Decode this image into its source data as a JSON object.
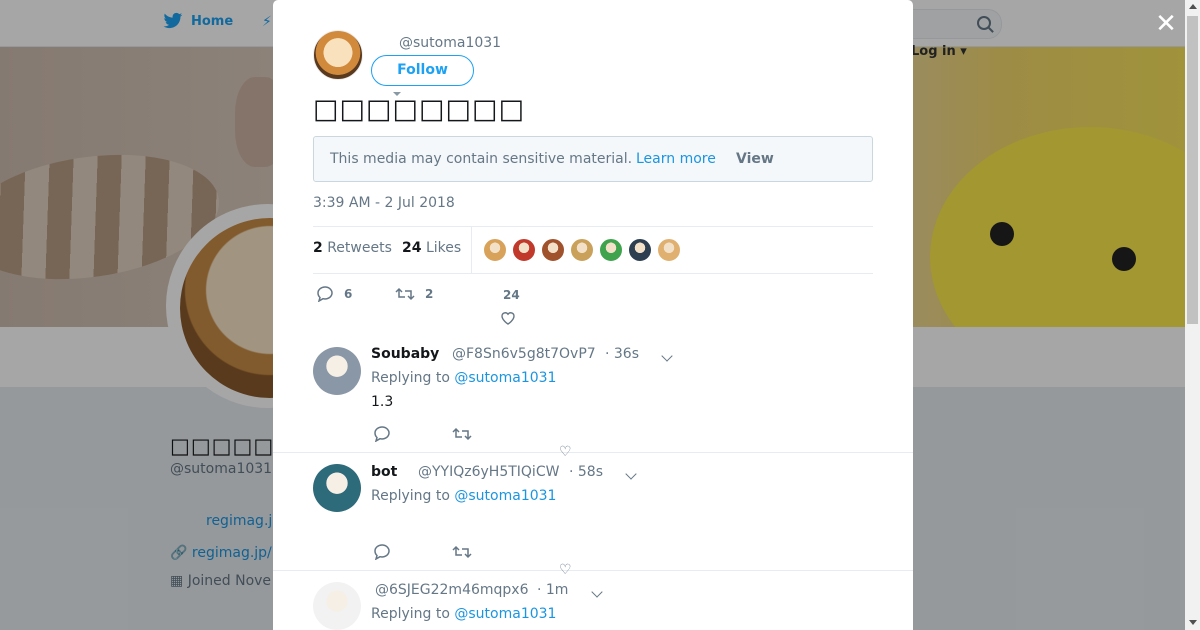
{
  "nav": {
    "home_label": "Home",
    "login_label": "Log in"
  },
  "profile": {
    "name": "□□□□□",
    "handle": "@sutoma1031",
    "link_short": "regimag.j",
    "link_full": "regimag.jp/",
    "joined": "Joined Nove"
  },
  "close_label": "✕",
  "tweet": {
    "handle": "@sutoma1031",
    "follow_label": "Follow",
    "text": "□□□□□□□□",
    "sensitive_message": "This media may contain sensitive material.",
    "learn_more": "Learn more",
    "view_label": "View",
    "timestamp": "3:39 AM - 2 Jul 2018",
    "retweets_count": "2",
    "retweets_label": "Retweets",
    "likes_count": "24",
    "likes_label": "Likes",
    "liker_colors": [
      "#d9a25a",
      "#c0392b",
      "#a0522d",
      "#caa15a",
      "#3fa34d",
      "#2c3e50",
      "#e0b070"
    ],
    "actions": {
      "replies": "6",
      "retweets": "2",
      "likes": "24"
    }
  },
  "replies": [
    {
      "name": "Soubaby",
      "handle": "@F8Sn6v5g8t7OvP7",
      "time": "· 36s",
      "replying_prefix": "Replying to",
      "replying_to": "@sutoma1031",
      "body": "1.3",
      "avatar_color": "#8a97a6"
    },
    {
      "name": "bot",
      "handle": "@YYIQz6yH5TIQiCW",
      "time": "· 58s",
      "replying_prefix": "Replying to",
      "replying_to": "@sutoma1031",
      "body": "",
      "avatar_color": "#2d6a7a"
    },
    {
      "name": "",
      "handle": "@6SJEG22m46mqpx6",
      "time": "· 1m",
      "replying_prefix": "Replying to",
      "replying_to": "@sutoma1031",
      "body": "",
      "avatar_color": "#f2f2f2"
    }
  ]
}
